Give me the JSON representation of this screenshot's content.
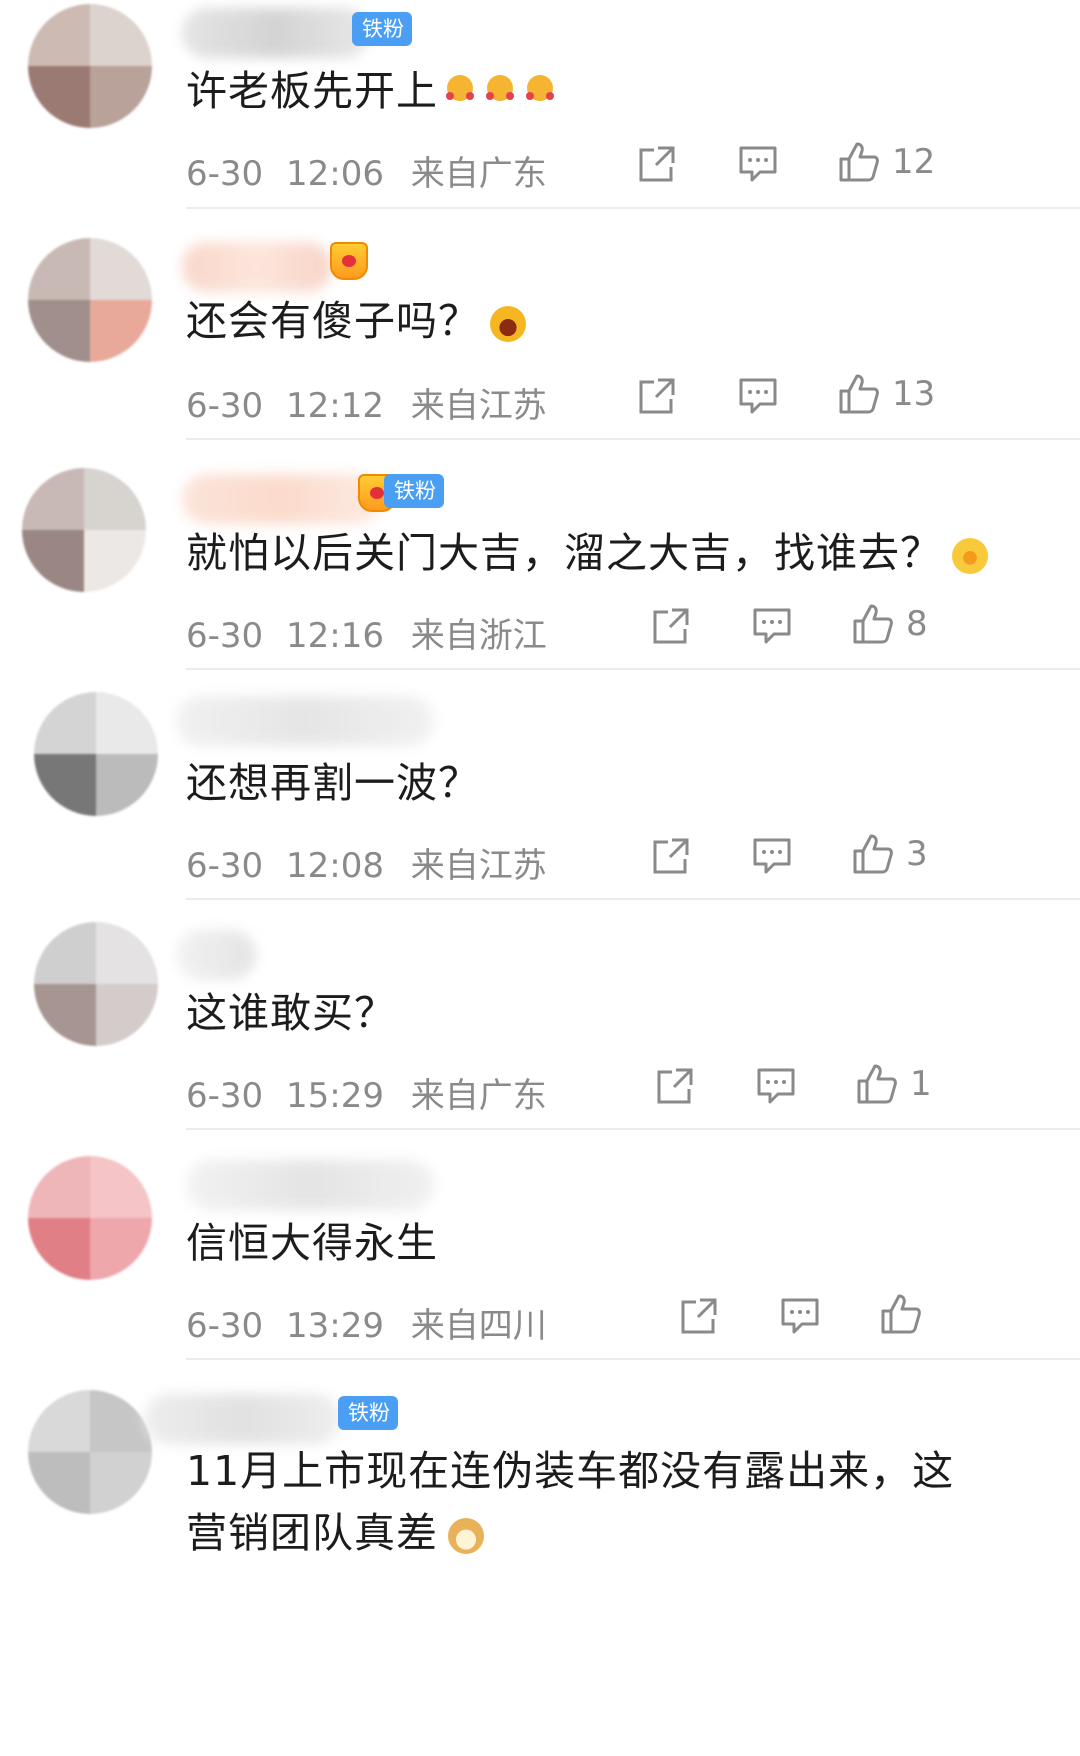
{
  "badges": {
    "fan": "铁粉"
  },
  "comments": [
    {
      "text": "许老板先开上",
      "date": "6-30",
      "time": "12:06",
      "location": "来自广东",
      "likes": "12"
    },
    {
      "text": "还会有傻子吗？",
      "date": "6-30",
      "time": "12:12",
      "location": "来自江苏",
      "likes": "13"
    },
    {
      "text": "就怕以后关门大吉，溜之大吉，找谁去？",
      "date": "6-30",
      "time": "12:16",
      "location": "来自浙江",
      "likes": "8"
    },
    {
      "text": "还想再割一波？",
      "date": "6-30",
      "time": "12:08",
      "location": "来自江苏",
      "likes": "3"
    },
    {
      "text": "这谁敢买？",
      "date": "6-30",
      "time": "15:29",
      "location": "来自广东",
      "likes": "1"
    },
    {
      "text": "信恒大得永生",
      "date": "6-30",
      "time": "13:29",
      "location": "来自四川",
      "likes": ""
    },
    {
      "text": "11月上市现在连伪装车都没有露出来，这营销团队真差",
      "date": "",
      "time": "",
      "location": "",
      "likes": ""
    }
  ],
  "icons": {
    "forward": "share-arrow-icon",
    "reply": "comment-bubble-icon",
    "like": "thumbs-up-icon"
  }
}
